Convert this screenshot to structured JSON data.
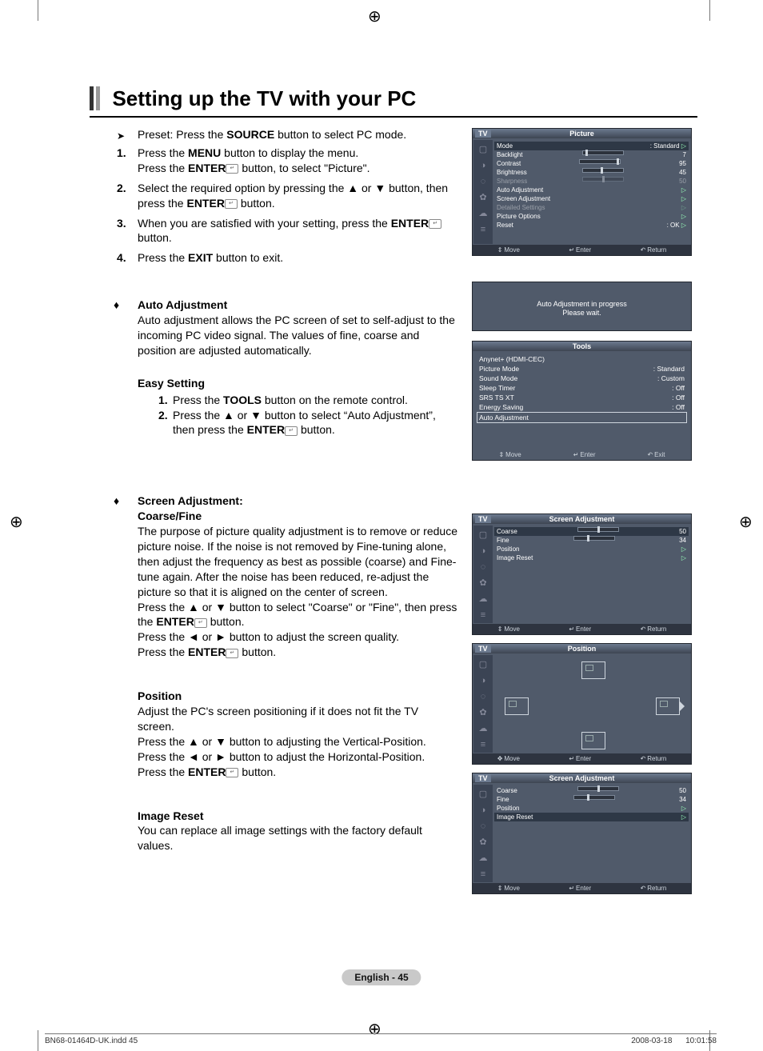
{
  "title": "Setting up the TV with your PC",
  "preset": {
    "pre": "Preset: Press the ",
    "b": "SOURCE",
    "post": " button to select PC mode."
  },
  "steps": [
    {
      "n": "1.",
      "l1a": "Press the ",
      "l1b": "MENU",
      "l1c": " button to display the menu.",
      "l2a": "Press the ",
      "l2b": "ENTER",
      "l2c": " button, to select \"Picture\"."
    },
    {
      "n": "2.",
      "l1": "Select the required option by pressing the ▲ or ▼ button, then press the ",
      "b": "ENTER",
      "post": " button."
    },
    {
      "n": "3.",
      "l1": "When you are satisfied with your setting, press the ",
      "b": "ENTER",
      "post": " button."
    },
    {
      "n": "4.",
      "l1": "Press the ",
      "b": "EXIT",
      "post": " button to exit."
    }
  ],
  "auto_adj": {
    "title": "Auto Adjustment",
    "body": "Auto adjustment allows the PC screen of set to self-adjust to the incoming PC video signal. The values of fine, coarse and position are adjusted automatically."
  },
  "easy": {
    "title": "Easy Setting",
    "s1a": "Press the ",
    "s1b": "TOOLS",
    "s1c": " button on the remote control.",
    "s2a": "Press the ▲ or ▼ button to select “Auto Adjustment”, then press the ",
    "s2b": "ENTER",
    "s2c": " button."
  },
  "screen_adj": {
    "title": "Screen Adjustment:",
    "sub": "Coarse/Fine",
    "p": "The purpose of picture quality adjustment is to remove or reduce picture noise. If the noise is not removed by Fine-tuning alone, then adjust the frequency as best as possible (coarse) and Fine-tune again. After the noise has been reduced, re-adjust the picture so that it is aligned on the center of screen.",
    "p2a": "Press the ▲ or ▼ button to select \"Coarse\" or \"Fine\", then press the ",
    "p2b": "ENTER",
    "p2c": " button.",
    "p3": "Press the ◄ or ► button to adjust the screen quality.",
    "p4a": "Press the ",
    "p4b": "ENTER",
    "p4c": " button."
  },
  "position": {
    "title": "Position",
    "p": "Adjust the PC's screen positioning if it does not fit the TV screen.",
    "p2": "Press the ▲ or ▼ button to adjusting the Vertical-Position.",
    "p3": "Press the ◄ or ► button to adjust the Horizontal-Position.",
    "p4a": "Press the ",
    "p4b": "ENTER",
    "p4c": " button."
  },
  "image_reset": {
    "title": "Image Reset",
    "p": "You can replace all image settings with the factory default values."
  },
  "page_num": "English - 45",
  "foot_l": "BN68-01464D-UK.indd   45",
  "foot_r": "2008-03-18      10:01:58",
  "osd_picture": {
    "tv": "TV",
    "title": "Picture",
    "rows": [
      {
        "k": "Mode",
        "v": ": Standard",
        "hl": true,
        "tri": true
      },
      {
        "k": "Backlight",
        "slider": 7,
        "v": "7"
      },
      {
        "k": "Contrast",
        "slider": 95,
        "v": "95"
      },
      {
        "k": "Brightness",
        "slider": 45,
        "v": "45"
      },
      {
        "k": "Sharpness",
        "slider": 50,
        "v": "50",
        "dim": true
      },
      {
        "k": "Auto Adjustment",
        "v": "",
        "tri": true
      },
      {
        "k": "Screen Adjustment",
        "v": "",
        "tri": true
      },
      {
        "k": "Detailed Settings",
        "v": "",
        "dim": true,
        "tri": true
      },
      {
        "k": "Picture Options",
        "v": "",
        "tri": true
      },
      {
        "k": "Reset",
        "v": ": OK",
        "tri": true
      }
    ],
    "ftr": {
      "move": "Move",
      "enter": "Enter",
      "ret": "Return"
    }
  },
  "osd_auto": {
    "l1": "Auto Adjustment in progress",
    "l2": "Please wait."
  },
  "osd_tools": {
    "title": "Tools",
    "rows": [
      {
        "k": "Anynet+ (HDMI-CEC)",
        "v": ""
      },
      {
        "k": "Picture Mode",
        "v": ": Standard"
      },
      {
        "k": "Sound Mode",
        "v": ": Custom"
      },
      {
        "k": "Sleep Timer",
        "v": ": Off"
      },
      {
        "k": "SRS TS XT",
        "v": ": Off"
      },
      {
        "k": "Energy Saving",
        "v": ": Off"
      },
      {
        "k": "Auto Adjustment",
        "v": "",
        "sel": true
      }
    ],
    "ftr": {
      "move": "Move",
      "enter": "Enter",
      "exit": "Exit"
    }
  },
  "osd_sa": {
    "tv": "TV",
    "title": "Screen Adjustment",
    "rows": [
      {
        "k": "Coarse",
        "slider": 50,
        "v": "50",
        "hl": true
      },
      {
        "k": "Fine",
        "slider": 34,
        "v": "34"
      },
      {
        "k": "Position",
        "v": "",
        "tri": true
      },
      {
        "k": "Image Reset",
        "v": "",
        "tri": true
      }
    ],
    "ftr": {
      "move": "Move",
      "enter": "Enter",
      "ret": "Return"
    }
  },
  "osd_pos": {
    "tv": "TV",
    "title": "Position",
    "ftr": {
      "move": "Move",
      "enter": "Enter",
      "ret": "Return"
    }
  },
  "osd_sa2": {
    "tv": "TV",
    "title": "Screen Adjustment",
    "rows": [
      {
        "k": "Coarse",
        "slider": 50,
        "v": "50"
      },
      {
        "k": "Fine",
        "slider": 34,
        "v": "34"
      },
      {
        "k": "Position",
        "v": "",
        "tri": true
      },
      {
        "k": "Image Reset",
        "v": "",
        "tri": true,
        "hl": true
      }
    ],
    "ftr": {
      "move": "Move",
      "enter": "Enter",
      "ret": "Return"
    }
  }
}
